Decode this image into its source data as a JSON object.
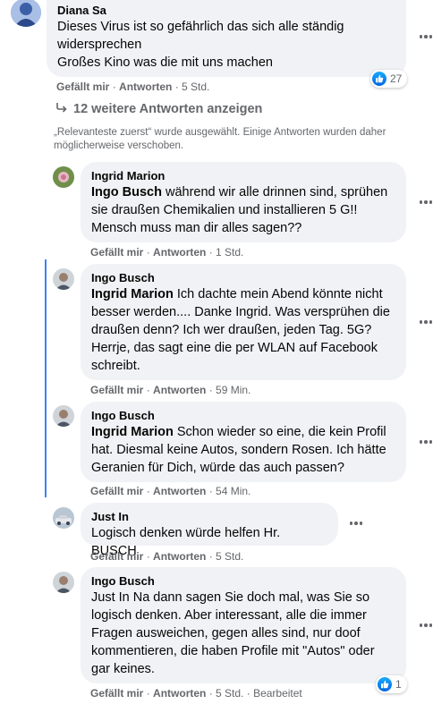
{
  "comments": {
    "diana": {
      "author": "Diana Sa",
      "lines": [
        "Dieses Virus ist so gefährlich das sich alle ständig",
        "widersprechen",
        "Großes Kino was die mit uns machen"
      ],
      "like_label": "Gefällt mir",
      "reply_label": "Antworten",
      "time": "5 Std.",
      "reaction_count": "27"
    },
    "ingrid": {
      "author": "Ingrid Marion",
      "mention": "Ingo Busch",
      "text": "während wir alle drinnen sind, sprühen sie draußen Chemikalien und installieren 5 G!! Mensch muss man dir alles sagen??",
      "like_label": "Gefällt mir",
      "reply_label": "Antworten",
      "time": "1 Std."
    },
    "ingo1": {
      "author": "Ingo Busch",
      "mention": "Ingrid Marion",
      "text": "Ich dachte mein Abend könnte nicht besser werden.... Danke Ingrid. Was versprühen die draußen denn? Ich wer draußen, jeden Tag. 5G? Herrje, das sagt eine die per WLAN auf Facebook schreibt.",
      "like_label": "Gefällt mir",
      "reply_label": "Antworten",
      "time": "59 Min."
    },
    "ingo2": {
      "author": "Ingo Busch",
      "mention": "Ingrid Marion",
      "text": "Schon wieder so eine, die kein Profil hat. Diesmal keine Autos, sondern Rosen. Ich hätte Geranien für Dich, würde das auch passen?",
      "like_label": "Gefällt mir",
      "reply_label": "Antworten",
      "time": "54 Min."
    },
    "justin": {
      "author": "Just In",
      "text": "Logisch denken würde helfen Hr. BUSCH",
      "like_label": "Gefällt mir",
      "reply_label": "Antworten",
      "time": "5 Std."
    },
    "ingo3": {
      "author": "Ingo Busch",
      "text": "Just In Na dann sagen Sie doch mal, was Sie so logisch denken. Aber interessant, alle die immer Fragen ausweichen, gegen alles sind, nur doof kommentieren, die haben Profile mit \"Autos\" oder gar keines.",
      "like_label": "Gefällt mir",
      "reply_label": "Antworten",
      "time": "5 Std.",
      "edited": "Bearbeitet",
      "reaction_count": "1"
    }
  },
  "more_replies": "12 weitere Antworten anzeigen",
  "relevance_note": "„Relevanteste zuerst“ wurde ausgewählt. Einige Antworten wurden daher möglicherweise verschoben.",
  "colors": {
    "bubble": "#f0f2f5",
    "meta": "#65676b",
    "thread_line": "#3b82f6",
    "like_blue": "#0165e1"
  },
  "icons": {
    "more": "more-options-icon",
    "reply_arrow": "reply-arrow-icon",
    "like": "like-reaction-icon"
  }
}
